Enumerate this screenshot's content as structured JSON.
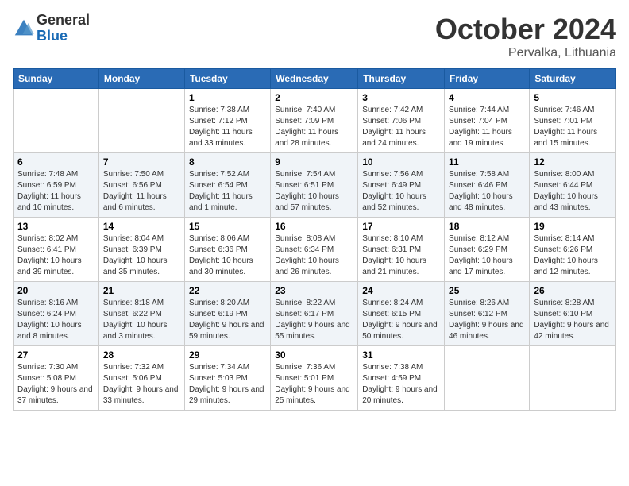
{
  "header": {
    "logo_general": "General",
    "logo_blue": "Blue",
    "month_title": "October 2024",
    "location": "Pervalka, Lithuania"
  },
  "days_of_week": [
    "Sunday",
    "Monday",
    "Tuesday",
    "Wednesday",
    "Thursday",
    "Friday",
    "Saturday"
  ],
  "weeks": [
    [
      {
        "day": "",
        "info": ""
      },
      {
        "day": "",
        "info": ""
      },
      {
        "day": "1",
        "info": "Sunrise: 7:38 AM\nSunset: 7:12 PM\nDaylight: 11 hours and 33 minutes."
      },
      {
        "day": "2",
        "info": "Sunrise: 7:40 AM\nSunset: 7:09 PM\nDaylight: 11 hours and 28 minutes."
      },
      {
        "day": "3",
        "info": "Sunrise: 7:42 AM\nSunset: 7:06 PM\nDaylight: 11 hours and 24 minutes."
      },
      {
        "day": "4",
        "info": "Sunrise: 7:44 AM\nSunset: 7:04 PM\nDaylight: 11 hours and 19 minutes."
      },
      {
        "day": "5",
        "info": "Sunrise: 7:46 AM\nSunset: 7:01 PM\nDaylight: 11 hours and 15 minutes."
      }
    ],
    [
      {
        "day": "6",
        "info": "Sunrise: 7:48 AM\nSunset: 6:59 PM\nDaylight: 11 hours and 10 minutes."
      },
      {
        "day": "7",
        "info": "Sunrise: 7:50 AM\nSunset: 6:56 PM\nDaylight: 11 hours and 6 minutes."
      },
      {
        "day": "8",
        "info": "Sunrise: 7:52 AM\nSunset: 6:54 PM\nDaylight: 11 hours and 1 minute."
      },
      {
        "day": "9",
        "info": "Sunrise: 7:54 AM\nSunset: 6:51 PM\nDaylight: 10 hours and 57 minutes."
      },
      {
        "day": "10",
        "info": "Sunrise: 7:56 AM\nSunset: 6:49 PM\nDaylight: 10 hours and 52 minutes."
      },
      {
        "day": "11",
        "info": "Sunrise: 7:58 AM\nSunset: 6:46 PM\nDaylight: 10 hours and 48 minutes."
      },
      {
        "day": "12",
        "info": "Sunrise: 8:00 AM\nSunset: 6:44 PM\nDaylight: 10 hours and 43 minutes."
      }
    ],
    [
      {
        "day": "13",
        "info": "Sunrise: 8:02 AM\nSunset: 6:41 PM\nDaylight: 10 hours and 39 minutes."
      },
      {
        "day": "14",
        "info": "Sunrise: 8:04 AM\nSunset: 6:39 PM\nDaylight: 10 hours and 35 minutes."
      },
      {
        "day": "15",
        "info": "Sunrise: 8:06 AM\nSunset: 6:36 PM\nDaylight: 10 hours and 30 minutes."
      },
      {
        "day": "16",
        "info": "Sunrise: 8:08 AM\nSunset: 6:34 PM\nDaylight: 10 hours and 26 minutes."
      },
      {
        "day": "17",
        "info": "Sunrise: 8:10 AM\nSunset: 6:31 PM\nDaylight: 10 hours and 21 minutes."
      },
      {
        "day": "18",
        "info": "Sunrise: 8:12 AM\nSunset: 6:29 PM\nDaylight: 10 hours and 17 minutes."
      },
      {
        "day": "19",
        "info": "Sunrise: 8:14 AM\nSunset: 6:26 PM\nDaylight: 10 hours and 12 minutes."
      }
    ],
    [
      {
        "day": "20",
        "info": "Sunrise: 8:16 AM\nSunset: 6:24 PM\nDaylight: 10 hours and 8 minutes."
      },
      {
        "day": "21",
        "info": "Sunrise: 8:18 AM\nSunset: 6:22 PM\nDaylight: 10 hours and 3 minutes."
      },
      {
        "day": "22",
        "info": "Sunrise: 8:20 AM\nSunset: 6:19 PM\nDaylight: 9 hours and 59 minutes."
      },
      {
        "day": "23",
        "info": "Sunrise: 8:22 AM\nSunset: 6:17 PM\nDaylight: 9 hours and 55 minutes."
      },
      {
        "day": "24",
        "info": "Sunrise: 8:24 AM\nSunset: 6:15 PM\nDaylight: 9 hours and 50 minutes."
      },
      {
        "day": "25",
        "info": "Sunrise: 8:26 AM\nSunset: 6:12 PM\nDaylight: 9 hours and 46 minutes."
      },
      {
        "day": "26",
        "info": "Sunrise: 8:28 AM\nSunset: 6:10 PM\nDaylight: 9 hours and 42 minutes."
      }
    ],
    [
      {
        "day": "27",
        "info": "Sunrise: 7:30 AM\nSunset: 5:08 PM\nDaylight: 9 hours and 37 minutes."
      },
      {
        "day": "28",
        "info": "Sunrise: 7:32 AM\nSunset: 5:06 PM\nDaylight: 9 hours and 33 minutes."
      },
      {
        "day": "29",
        "info": "Sunrise: 7:34 AM\nSunset: 5:03 PM\nDaylight: 9 hours and 29 minutes."
      },
      {
        "day": "30",
        "info": "Sunrise: 7:36 AM\nSunset: 5:01 PM\nDaylight: 9 hours and 25 minutes."
      },
      {
        "day": "31",
        "info": "Sunrise: 7:38 AM\nSunset: 4:59 PM\nDaylight: 9 hours and 20 minutes."
      },
      {
        "day": "",
        "info": ""
      },
      {
        "day": "",
        "info": ""
      }
    ]
  ]
}
